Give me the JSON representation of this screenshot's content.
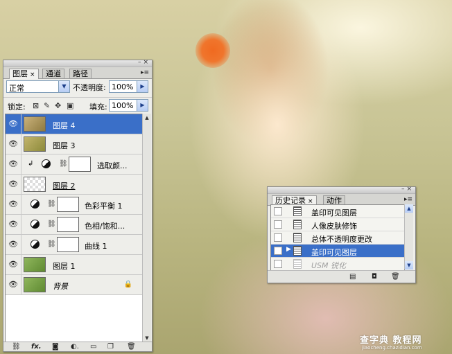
{
  "layers_panel": {
    "tabs": [
      {
        "label": "图层",
        "close": "×"
      },
      {
        "label": "通道"
      },
      {
        "label": "路径"
      }
    ],
    "blend_mode": "正常",
    "opacity_label": "不透明度:",
    "opacity_value": "100%",
    "lock_label": "锁定:",
    "fill_label": "填充:",
    "fill_value": "100%",
    "layers": [
      {
        "name": "图层 4",
        "selected": true
      },
      {
        "name": "图层 3"
      },
      {
        "name": "选取颜..."
      },
      {
        "name": "图层 2"
      },
      {
        "name": "色彩平衡 1"
      },
      {
        "name": "色相/饱和..."
      },
      {
        "name": "曲线 1"
      },
      {
        "name": "图层 1"
      },
      {
        "name": "背景"
      }
    ],
    "bottom_icons": [
      "link-icon",
      "fx-icon",
      "mask-icon",
      "adjustment-icon",
      "folder-icon",
      "new-layer-icon",
      "trash-icon"
    ]
  },
  "history_panel": {
    "tabs": [
      {
        "label": "历史记录",
        "close": "×"
      },
      {
        "label": "动作"
      }
    ],
    "items": [
      {
        "label": "盖印可见图层"
      },
      {
        "label": "人像皮肤修饰"
      },
      {
        "label": "总体不透明度更改"
      },
      {
        "label": "盖印可见图层",
        "selected": true
      },
      {
        "label": "USM 锐化",
        "dimmed": true
      }
    ],
    "bottom_icons": [
      "new-document-icon",
      "camera-icon",
      "trash-icon"
    ]
  },
  "watermark": {
    "line1": "查字典 教程网",
    "line2": "jiaocheng.chazidian.com"
  },
  "colors": {
    "selection": "#3a6fc8",
    "panel_bg": "#eeeeea"
  }
}
